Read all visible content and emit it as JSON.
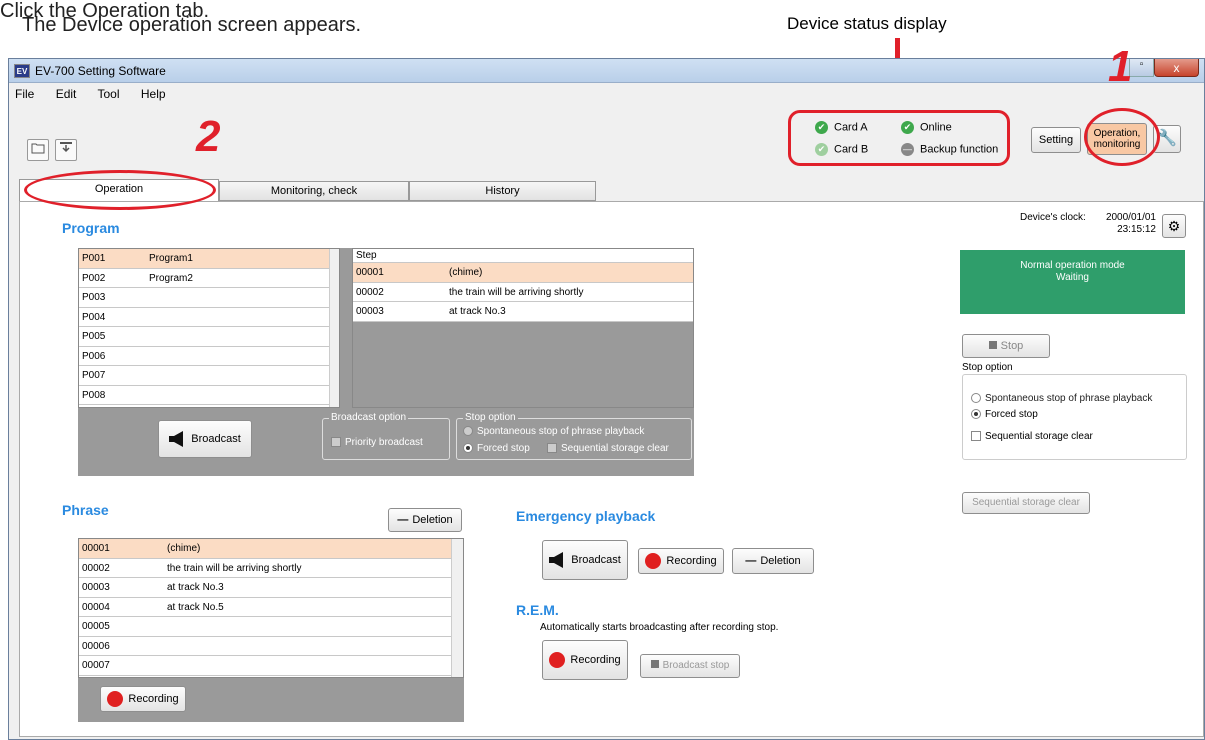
{
  "doc": {
    "line1": "Click the Operation tab.",
    "line2": "The Device operation screen appears.",
    "status_caption": "Device status display",
    "num1": "1",
    "num2": "2"
  },
  "window": {
    "title": "EV-700 Setting Software",
    "icon": "EV",
    "close": "x"
  },
  "menu": [
    "File",
    "Edit",
    "Tool",
    "Help"
  ],
  "toolbar": {
    "open_icon": "folder-icon",
    "download_icon": "download-icon"
  },
  "status": [
    {
      "label": "Card A",
      "state": "ok"
    },
    {
      "label": "Online",
      "state": "ok"
    },
    {
      "label": "Card B",
      "state": "ok-dim"
    },
    {
      "label": "Backup function",
      "state": "off"
    }
  ],
  "mode_buttons": {
    "setting": "Setting",
    "operation": "Operation,\nmonitoring"
  },
  "tabs": [
    "Operation",
    "Monitoring, check",
    "History"
  ],
  "program": {
    "title": "Program",
    "items": [
      {
        "id": "P001",
        "name": "Program1"
      },
      {
        "id": "P002",
        "name": "Program2"
      },
      {
        "id": "P003",
        "name": ""
      },
      {
        "id": "P004",
        "name": ""
      },
      {
        "id": "P005",
        "name": ""
      },
      {
        "id": "P006",
        "name": ""
      },
      {
        "id": "P007",
        "name": ""
      },
      {
        "id": "P008",
        "name": ""
      }
    ],
    "step_header": "Step",
    "steps": [
      {
        "id": "00001",
        "text": "(chime)"
      },
      {
        "id": "00002",
        "text": "the train will be arriving shortly"
      },
      {
        "id": "00003",
        "text": "at track No.3"
      }
    ],
    "broadcast": "Broadcast",
    "broadcast_option_label": "Broadcast option",
    "priority_broadcast": "Priority broadcast",
    "stop_option_label": "Stop option",
    "spontaneous": "Spontaneous stop of phrase playback",
    "forced": "Forced stop",
    "sequential": "Sequential storage clear"
  },
  "clock": {
    "label": "Device's clock:",
    "date": "2000/01/01",
    "time": "23:15:12"
  },
  "mode_panel": {
    "line1": "Normal operation mode",
    "line2": "Waiting",
    "color": "#2f9e6b"
  },
  "right": {
    "stop": "Stop",
    "stop_option": "Stop option",
    "spontaneous": "Spontaneous stop of phrase playback",
    "forced": "Forced stop",
    "sequential": "Sequential storage clear",
    "seq_clear_btn": "Sequential storage clear"
  },
  "phrase": {
    "title": "Phrase",
    "deletion": "Deletion",
    "items": [
      {
        "id": "00001",
        "text": "(chime)"
      },
      {
        "id": "00002",
        "text": "the train will be arriving shortly"
      },
      {
        "id": "00003",
        "text": "at track No.3"
      },
      {
        "id": "00004",
        "text": "at track No.5"
      },
      {
        "id": "00005",
        "text": ""
      },
      {
        "id": "00006",
        "text": ""
      },
      {
        "id": "00007",
        "text": ""
      }
    ],
    "recording": "Recording"
  },
  "emergency": {
    "title": "Emergency playback",
    "broadcast": "Broadcast",
    "recording": "Recording",
    "deletion": "Deletion"
  },
  "rem": {
    "title": "R.E.M.",
    "desc": "Automatically starts broadcasting after recording stop.",
    "recording": "Recording",
    "broadcast_stop": "Broadcast stop"
  }
}
